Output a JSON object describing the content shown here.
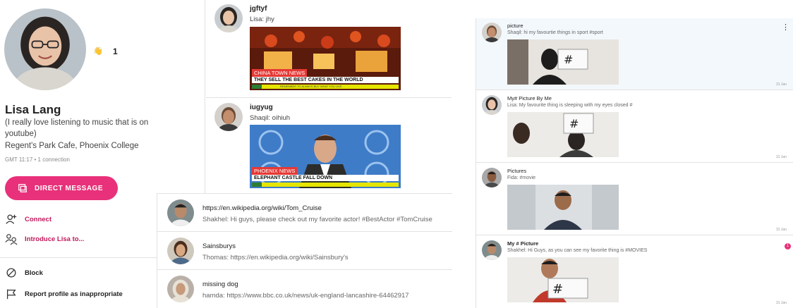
{
  "profile": {
    "name": "Lisa Lang",
    "bio": "(I really love listening to music that is on youtube)",
    "location": "Regent's Park Cafe, Phoenix College",
    "meta": "GMT 11:17  •  1 connection",
    "wave_count": "1",
    "dm_label": "DIRECT MESSAGE",
    "connect_label": "Connect",
    "introduce_label": "Introduce Lisa to...",
    "block_label": "Block",
    "report_label": "Report profile as inappropriate"
  },
  "middle_posts": [
    {
      "title": "jgftyf",
      "subtitle": "Lisa: jhy",
      "news_tag": "CHINA TOWN NEWS",
      "headline": "THEY SELL THE BEST CAKES IN THE WORLD",
      "ticker": "REMEMBER TO ALWAYS BUY WHAT YOU LIKE"
    },
    {
      "title": "iugyug",
      "subtitle": "Shaqil: oihiuh",
      "news_tag": "PHOENIX NEWS",
      "headline": "ELEPHANT CASTLE FALL DOWN",
      "ticker": ""
    }
  ],
  "links": [
    {
      "title": "https://en.wikipedia.org/wiki/Tom_Cruise",
      "subtitle": "Shakhel: Hi guys, please check out my favorite actor! #BestActor #TomCruise"
    },
    {
      "title": "Sainsburys",
      "subtitle": "Thomas: https://en.wikipedia.org/wiki/Sainsbury's"
    },
    {
      "title": "missing dog",
      "subtitle": "hamda: https://www.bbc.co.uk/news/uk-england-lancashire-64462917"
    }
  ],
  "right_posts": [
    {
      "title": "picture",
      "subtitle": "Shaqil: hi my favourtie things in sport #sport",
      "date": "31 Jan"
    },
    {
      "title": "My# Picture By Me",
      "subtitle": "Lisa: My favourite thing is sleeping with my eyes closed #",
      "date": "31 Jan"
    },
    {
      "title": "Pictures",
      "subtitle": "Fida: #movie",
      "date": "31 Jan"
    },
    {
      "title": "My # Picture",
      "subtitle": "Shakhel: Hi Guys, as you can see my favorite thing is #MOVIES",
      "date": "31 Jan",
      "badge": "1"
    }
  ],
  "colors": {
    "accent": "#e8317a",
    "link_pink": "#c2185b",
    "news_red": "#e53935",
    "ticker_yellow": "#e5e500"
  }
}
